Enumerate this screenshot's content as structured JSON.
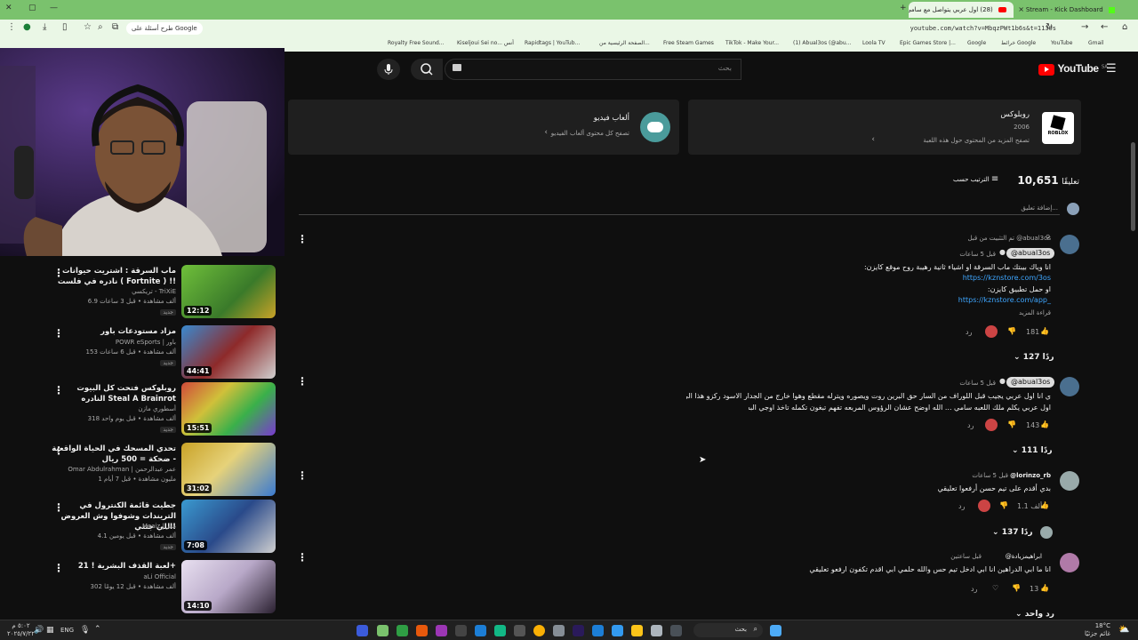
{
  "browser": {
    "tabs": [
      {
        "label": "Stream - Kick Dashboard",
        "active": false
      },
      {
        "label": "(28) اول عربي يتواصل مع سامي",
        "active": true
      }
    ],
    "url": "youtube.com/watch?v=MbqzPWt1b6s&t=1130s",
    "google_pill": "طرح أسئلة على Google",
    "bookmarks": [
      "Royalty Free Sound...",
      "Kiseljoui Sei no... أنس",
      "Rapidtags | YouTub...",
      "الصفحة الرئيسية من...",
      "Free Steam Games",
      "TikTok - Make Your...",
      "(1) Abual3os (@abu...",
      "Loola TV",
      "Epic Games Store |...",
      "Google",
      "خرائط Google",
      "YouTube",
      "Gmail"
    ]
  },
  "youtube": {
    "logo_text": "YouTube",
    "logo_sup": "SA",
    "search_placeholder": "بحث"
  },
  "cards": [
    {
      "title": "روبلوكس",
      "year": "2006",
      "sub": "تصفح المزيد من المحتوى حول هذه اللعبة",
      "icon_text": "ROBLOX"
    },
    {
      "title": "ألعاب فيديو",
      "sub": "تصفح كل محتوى ألعاب الفيديو"
    }
  ],
  "comments_header": {
    "count": "10,651",
    "count_label": "تعليقًا",
    "sort_label": "الترتيب حسب",
    "add_placeholder": "إضافة تعليق..."
  },
  "comments": [
    {
      "pinned": "تم التثبيت من قبل @abual3os",
      "author": "@abual3os",
      "time": "قبل 5 ساعات",
      "lines": [
        "انا وياك بيبتك ماب السرقة او اشياء ثانية رهيبة روح موقع كايزن:",
        "او حمل تطبيق كايزن:"
      ],
      "links": [
        "https://kznstore.com/3os",
        "https://kznstore.com/app_"
      ],
      "more": "قراءة المزيد",
      "likes": "181",
      "reply_label": "رد",
      "replies": "127 ردًا"
    },
    {
      "author": "@abual3os",
      "time": "قبل 5 ساعات",
      "lines": [
        "ي انا اول عربي يجيب قبل اللوراف من السار حق البرين روت ويصوره ويترله مقطع وهوا خارج من الجدار الاسود ركزو هذا الي الصدمة",
        "اول عربي يكلم ملك اللعبه سامي ... الله اوضح عشان الرؤوس المربعه تفهم تبغون تكمله تاخذ اوجي البسه"
      ],
      "likes": "143",
      "reply_label": "رد",
      "replies": "111 ردًا"
    },
    {
      "author": "@lorinzo_rb",
      "time": "قبل 5 ساعات",
      "lines": [
        "بدي أقدم على تيم حسن أرفعوا تعليقي"
      ],
      "likes": "1.1 ألف",
      "reply_label": "رد",
      "replies": "137 ردًا"
    },
    {
      "author": "@ابراهيمزيادة",
      "time": "قبل ساعتين",
      "lines": [
        "انا ما ابي الدراهين انا ابي ادخل تيم حس والله حلمي ابي اقدم تكفون ارفعو تعليقي"
      ],
      "likes": "13",
      "reply_label": "رد",
      "replies": "رد واحد"
    }
  ],
  "sidebar": [
    {
      "title": "ماب السرقة : اشتريت حيوانات نادره في فلست ( Fortnite ) !!",
      "channel": "تريكسي - TriXiE",
      "meta": "6.9 ألف مشاهدة • قبل 3 ساعات",
      "badge": "جديد",
      "duration": "12:12"
    },
    {
      "title": "مزاد مستودعات باور",
      "channel": "POWR eSports | باور",
      "meta": "153 ألف مشاهدة • قبل 6 ساعات",
      "badge": "جديد",
      "duration": "44:41"
    },
    {
      "title": "روبلوكس فتحت كل البيوت النادره Steal A Brainrot",
      "channel": "أسطوري مازن",
      "meta": "318 ألف مشاهدة • قبل يوم واحد",
      "badge": "جديد",
      "duration": "15:51"
    },
    {
      "title": "تحدي المسحك في الحياة الواقعية - ضحكة = 500 ريال",
      "channel": "Omar Abdulrahman | عمر عبدالرحمن",
      "meta": "1 مليون مشاهدة • قبل 7 أيام",
      "badge": "",
      "duration": "31:02"
    },
    {
      "title": "جطيت قائمة الكنترول في التريندات وشوفوا وش العروض اللي جتني!",
      "channel": "Moaiz | معز",
      "meta": "4.1 ألف مشاهدة • قبل يومين",
      "badge": "جديد",
      "duration": "7:08"
    },
    {
      "title": "لعبة القذف البشرية ! 21+",
      "channel": "aLi Official",
      "meta": "302 ألف مشاهدة • قبل 12 يومًا",
      "badge": "",
      "duration": "14:10"
    }
  ],
  "taskbar": {
    "search_label": "بحث",
    "lang": "ENG",
    "time": "٥:٠٢ م",
    "date": "٢٠٢٥/٧/٢٢",
    "weather": "18°C",
    "weather_sub": "غائم جزئيًا"
  },
  "colors": {
    "tabbar": "#7ac26d",
    "page_bg": "#0f0f0f",
    "link": "#3ea6ff",
    "yt_red": "#ff0000"
  }
}
